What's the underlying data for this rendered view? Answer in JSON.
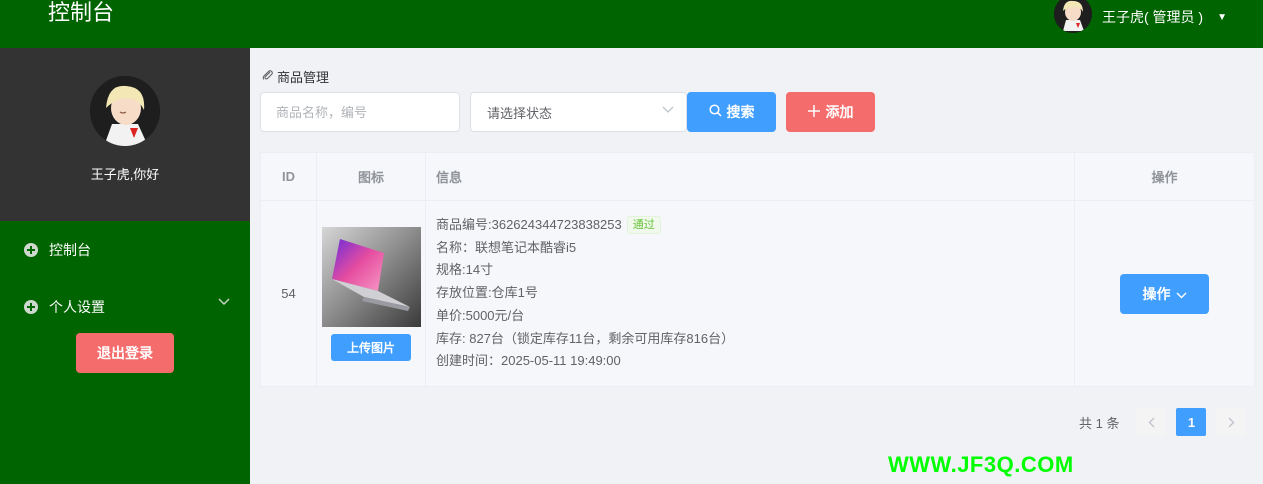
{
  "header": {
    "title": "控制台",
    "user_label": "王子虎( 管理员 )"
  },
  "sidebar": {
    "greeting": "王子虎,你好",
    "items": [
      {
        "label": "控制台",
        "icon": "circle-plus-icon"
      },
      {
        "label": "个人设置",
        "icon": "circle-plus-icon"
      }
    ],
    "logout_label": "退出登录"
  },
  "page": {
    "breadcrumb": "商品管理"
  },
  "toolbar": {
    "search_placeholder": "商品名称，编号",
    "status_placeholder": "请选择状态",
    "search_label": "搜索",
    "add_label": "添加"
  },
  "table": {
    "headers": {
      "id": "ID",
      "icon": "图标",
      "info": "信息",
      "op": "操作"
    },
    "rows": [
      {
        "id": "54",
        "upload_label": "上传图片",
        "code_line": "商品编号:362624344723838253",
        "status_tag": "通过",
        "name_line": "名称：联想笔记本酷睿i5",
        "spec_line": "规格:14寸",
        "location_line": "存放位置:仓库1号",
        "price_line": "单价:5000元/台",
        "stock_line": "库存: 827台（锁定库存11台，剩余可用库存816台）",
        "created_line": "创建时间：2025-05-11 19:49:00",
        "op_label": "操作"
      }
    ]
  },
  "pagination": {
    "total": "共 1 条",
    "current": "1"
  },
  "watermark": "WWW.JF3Q.COM"
}
